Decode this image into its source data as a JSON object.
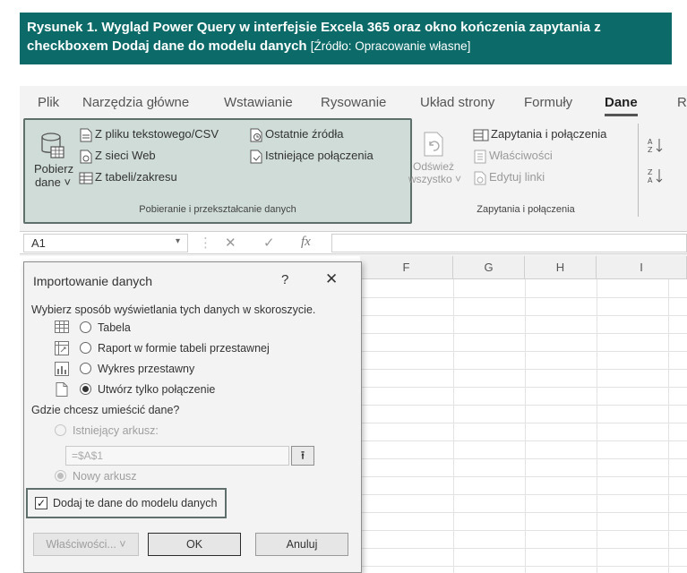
{
  "caption": {
    "title": "Rysunek 1. Wygląd Power Query w interfejsie Excela 365 oraz okno kończenia zapytania z checkboxem Dodaj dane do modelu danych",
    "source": "[Źródło: Opracowanie własne]"
  },
  "ribbon_tabs": [
    "Plik",
    "Narzędzia główne",
    "Wstawianie",
    "Rysowanie",
    "Układ strony",
    "Formuły",
    "Dane",
    "R"
  ],
  "active_tab": "Dane",
  "ribbon": {
    "get_data": {
      "label_line1": "Pobierz",
      "label_line2": "dane ˅",
      "from_text_csv": "Z pliku tekstowego/CSV",
      "from_web": "Z sieci Web",
      "from_table": "Z tabeli/zakresu",
      "recent_sources": "Ostatnie źródła",
      "existing_connections": "Istniejące połączenia",
      "group_label": "Pobieranie i przekształcanie danych"
    },
    "queries": {
      "refresh_line1": "Odśwież",
      "refresh_line2": "wszystko ˅",
      "queries_connections": "Zapytania i połączenia",
      "properties": "Właściwości",
      "edit_links": "Edytuj linki",
      "group_label": "Zapytania i połączenia"
    }
  },
  "formula_bar": {
    "name_box": "A1",
    "cancel": "✕",
    "enter": "✓",
    "fx": "fx"
  },
  "columns": [
    "F",
    "G",
    "H",
    "I"
  ],
  "dialog": {
    "title": "Importowanie danych",
    "help": "?",
    "close": "✕",
    "prompt_view": "Wybierz sposób wyświetlania tych danych w skoroszycie.",
    "options": [
      {
        "label": "Tabela",
        "selected": false
      },
      {
        "label": "Raport w formie tabeli przestawnej",
        "selected": false
      },
      {
        "label": "Wykres przestawny",
        "selected": false
      },
      {
        "label": "Utwórz tylko połączenie",
        "selected": true
      }
    ],
    "prompt_location": "Gdzie chcesz umieścić dane?",
    "existing_sheet": "Istniejący arkusz:",
    "cell_ref": "=$A$1",
    "new_sheet": "Nowy arkusz",
    "add_to_model": "Dodaj te dane do modelu danych",
    "add_to_model_checked": true,
    "properties_button": "Właściwości... ˅",
    "ok_button": "OK",
    "cancel_button": "Anuluj"
  },
  "colors": {
    "caption_bg": "#0c6b69",
    "highlight_border": "#5e6f6c",
    "highlight_fill": "#cfdcd8"
  }
}
